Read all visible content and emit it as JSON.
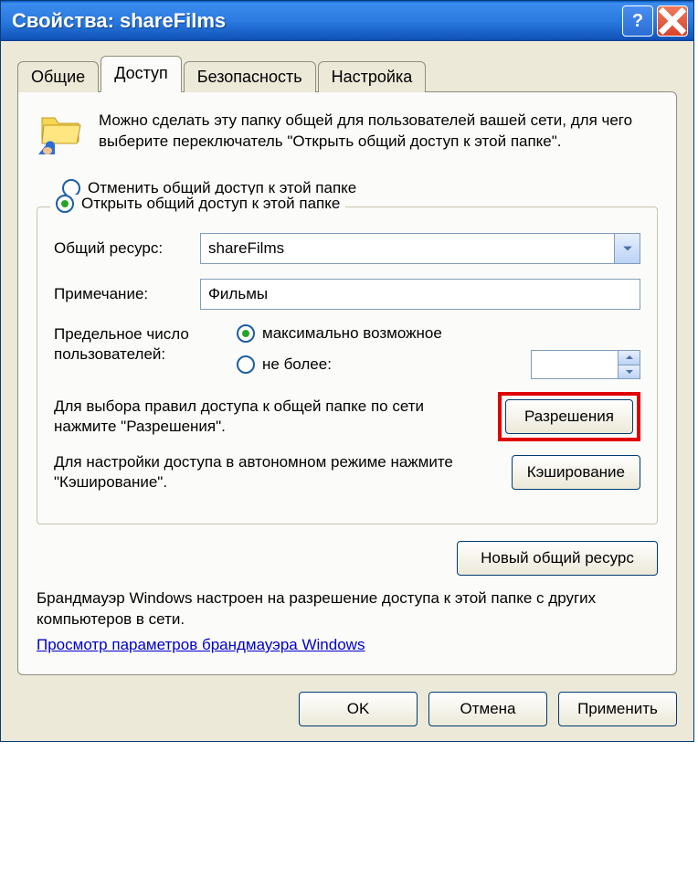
{
  "window": {
    "title": "Свойства: shareFilms"
  },
  "tabs": {
    "general": "Общие",
    "access": "Доступ",
    "security": "Безопасность",
    "settings": "Настройка"
  },
  "intro": "Можно сделать эту папку общей для пользователей вашей сети, для чего выберите переключатель \"Открыть общий доступ к этой папке\".",
  "radio": {
    "disable": "Отменить общий доступ к этой папке",
    "enable": "Открыть общий доступ к этой папке"
  },
  "share": {
    "resource_label": "Общий ресурс:",
    "resource_value": "shareFilms",
    "comment_label": "Примечание:",
    "comment_value": "Фильмы",
    "limit_label": "Предельное число пользователей:",
    "limit_max": "максимально возможное",
    "limit_nomore": "не более:",
    "perm_text": "Для выбора правил доступа к общей папке по сети нажмите \"Разрешения\".",
    "perm_btn": "Разрешения",
    "cache_text": "Для настройки доступа в автономном режиме нажмите \"Кэширование\".",
    "cache_btn": "Кэширование"
  },
  "new_share_btn": "Новый общий ресурс",
  "firewall": {
    "text": "Брандмауэр Windows настроен на разрешение доступа к этой папке с других компьютеров в сети.",
    "link": "Просмотр параметров брандмауэра Windows"
  },
  "buttons": {
    "ok": "OK",
    "cancel": "Отмена",
    "apply": "Применить"
  }
}
